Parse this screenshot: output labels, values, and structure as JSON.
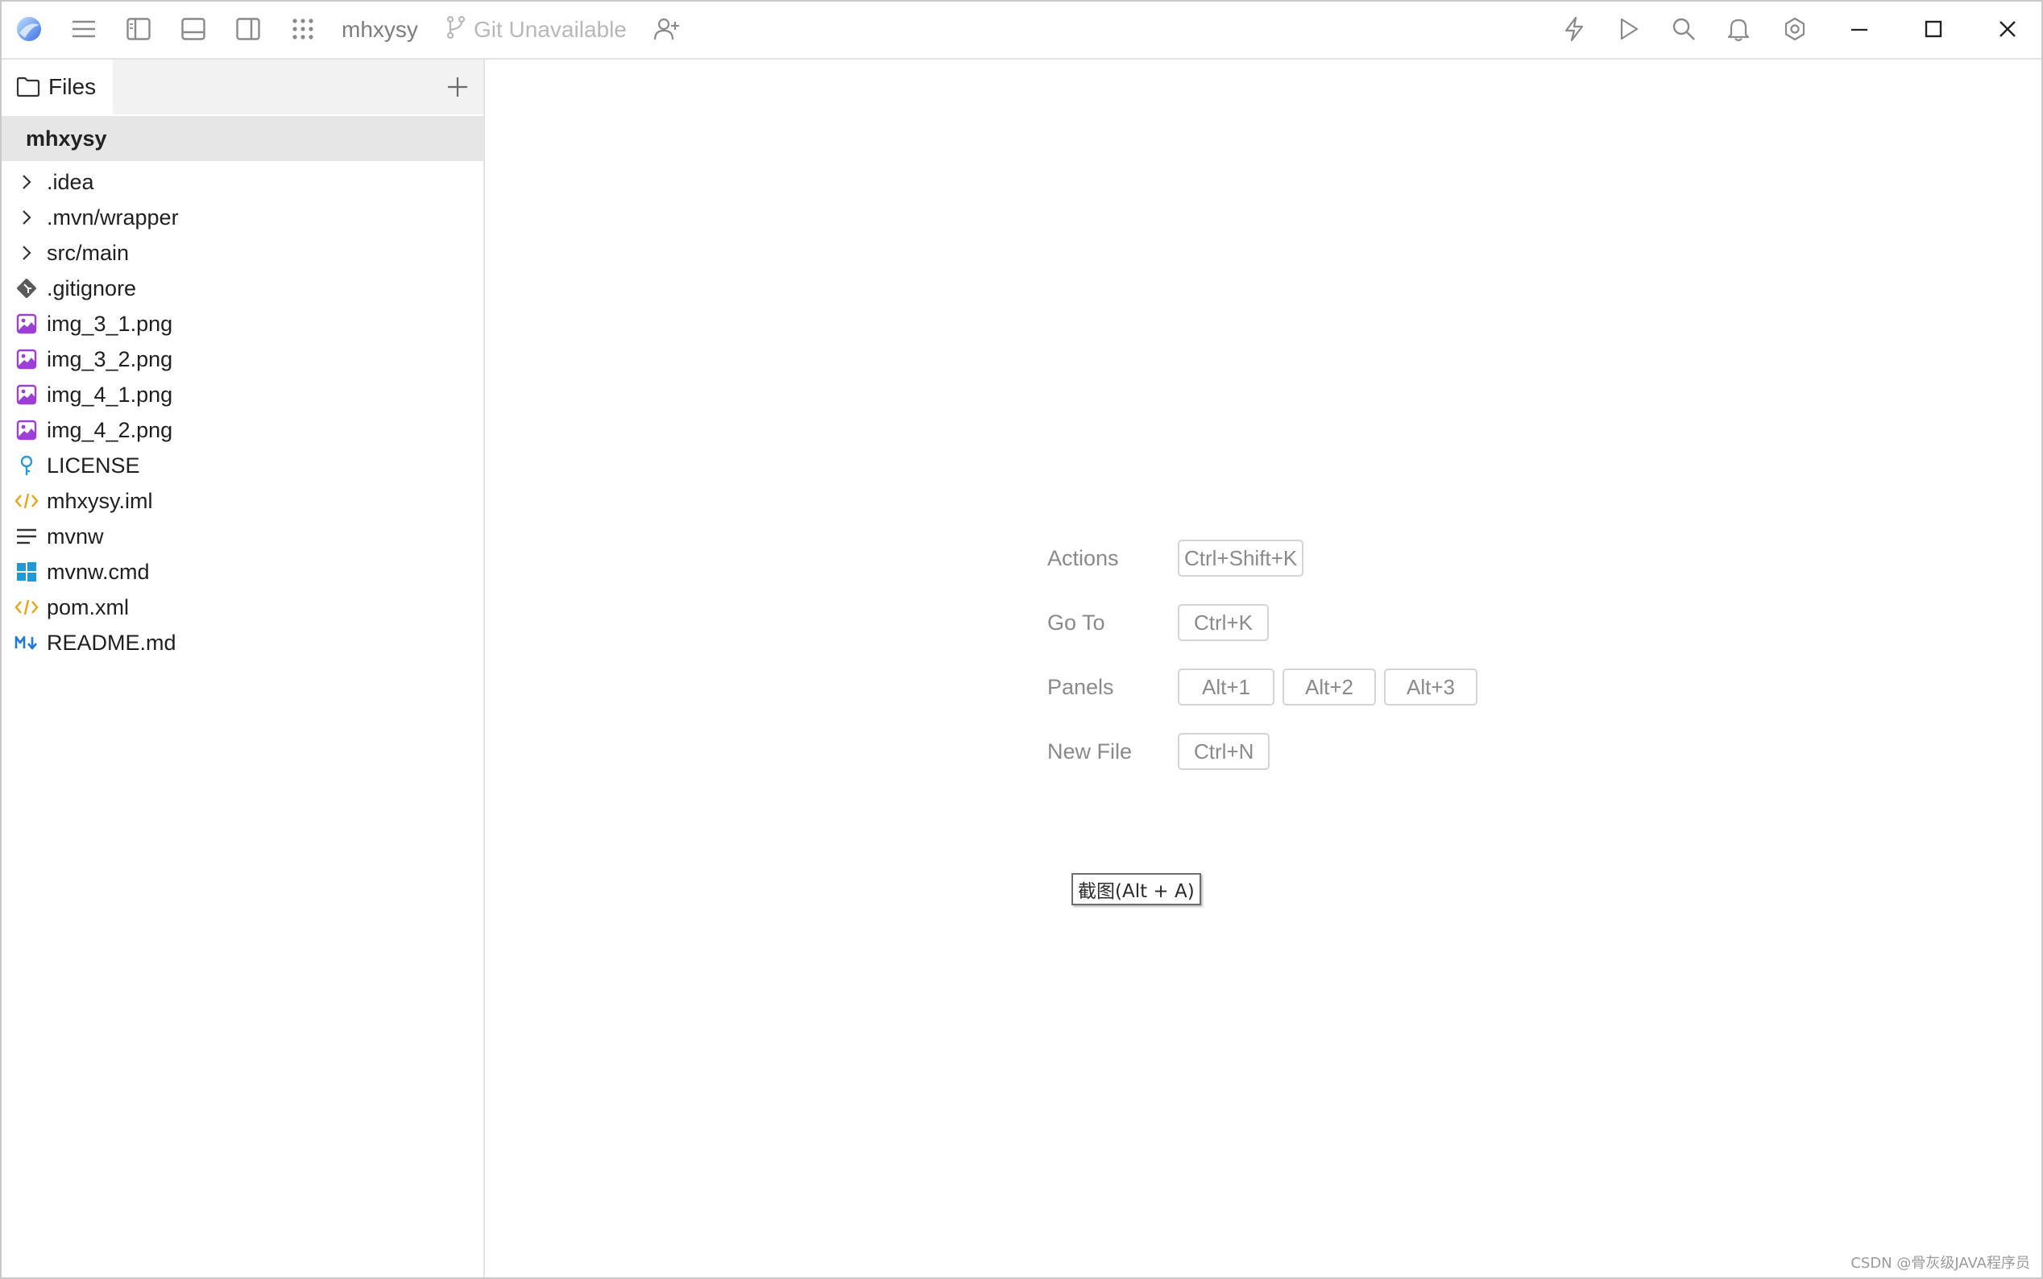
{
  "titlebar": {
    "workspace_name": "mhxysy",
    "git_status": "Git Unavailable",
    "icons": {
      "app": "app-logo-icon",
      "menu": "hamburger-menu-icon",
      "left_panel": "toggle-left-panel-icon",
      "bottom_panel": "toggle-bottom-panel-icon",
      "right_panel": "toggle-right-panel-icon",
      "apps": "apps-grid-icon",
      "git": "git-branch-icon",
      "collab": "add-collaborator-icon",
      "actions": "lightning-icon",
      "run": "play-icon",
      "search": "search-icon",
      "notifications": "bell-icon",
      "settings": "gear-icon",
      "minimize": "minimize-icon",
      "maximize": "maximize-icon",
      "close": "close-icon"
    }
  },
  "sidebar": {
    "tab_label": "Files",
    "root_folder": "mhxysy",
    "items": [
      {
        "label": ".idea",
        "icon": "chevron-right-icon",
        "kind": "folder"
      },
      {
        "label": ".mvn/wrapper",
        "icon": "chevron-right-icon",
        "kind": "folder"
      },
      {
        "label": "src/main",
        "icon": "chevron-right-icon",
        "kind": "folder"
      },
      {
        "label": ".gitignore",
        "icon": "git-file-icon",
        "kind": "git"
      },
      {
        "label": "img_3_1.png",
        "icon": "image-file-icon",
        "kind": "image"
      },
      {
        "label": "img_3_2.png",
        "icon": "image-file-icon",
        "kind": "image"
      },
      {
        "label": "img_4_1.png",
        "icon": "image-file-icon",
        "kind": "image"
      },
      {
        "label": "img_4_2.png",
        "icon": "image-file-icon",
        "kind": "image"
      },
      {
        "label": "LICENSE",
        "icon": "license-file-icon",
        "kind": "license"
      },
      {
        "label": "mhxysy.iml",
        "icon": "xml-file-icon",
        "kind": "xml"
      },
      {
        "label": "mvnw",
        "icon": "text-file-icon",
        "kind": "text"
      },
      {
        "label": "mvnw.cmd",
        "icon": "windows-file-icon",
        "kind": "windows"
      },
      {
        "label": "pom.xml",
        "icon": "xml-file-icon",
        "kind": "xml"
      },
      {
        "label": "README.md",
        "icon": "markdown-file-icon",
        "kind": "markdown"
      }
    ]
  },
  "shortcuts": {
    "actions": {
      "label": "Actions",
      "keys": [
        "Ctrl+Shift+K"
      ]
    },
    "goto": {
      "label": "Go To",
      "keys": [
        "Ctrl+K"
      ]
    },
    "panels": {
      "label": "Panels",
      "keys": [
        "Alt+1",
        "Alt+2",
        "Alt+3"
      ]
    },
    "newfile": {
      "label": "New File",
      "keys": [
        "Ctrl+N"
      ]
    }
  },
  "tooltip": "截图(Alt + A)",
  "watermark": "CSDN @骨灰级JAVA程序员",
  "colors": {
    "image_icon": "#9b3fd6",
    "xml_icon": "#e8a317",
    "windows_icon": "#1e9ad6",
    "markdown_icon": "#1e7ad6",
    "license_icon": "#2b9ad6",
    "git_icon": "#5a5a5a"
  }
}
